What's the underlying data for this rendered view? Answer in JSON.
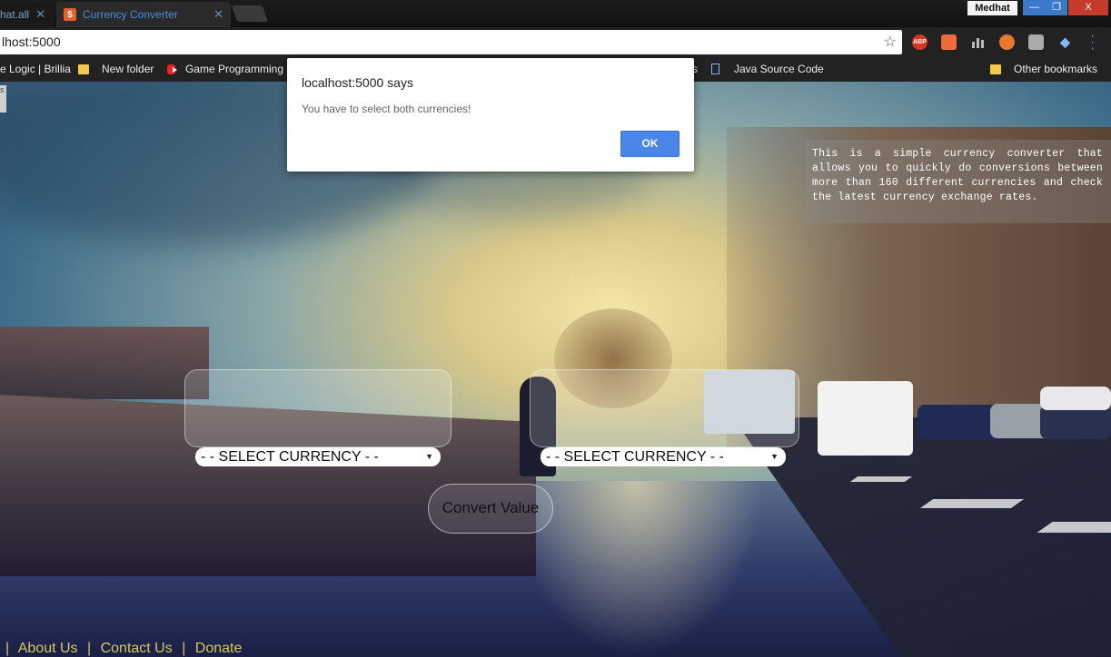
{
  "browser": {
    "tabs": [
      {
        "label": "hat.all",
        "active": false
      },
      {
        "label": "Currency Converter",
        "active": true,
        "favicon": "$"
      }
    ],
    "user_name": "Medhat",
    "window_controls": {
      "minimize": "—",
      "maximize": "❐",
      "close": "X"
    },
    "address": "lhost:5000",
    "extensions": [
      "ABP"
    ],
    "bookmarks": [
      {
        "label": "e Logic | Brillia",
        "icon": "page-icon"
      },
      {
        "label": "New folder",
        "icon": "folder-icon"
      },
      {
        "label": "Game Programming",
        "icon": "youtube-icon"
      },
      {
        "label": "s",
        "icon": "page-icon"
      },
      {
        "label": "Java Source Code",
        "icon": "document-icon"
      },
      {
        "label": "Other bookmarks",
        "icon": "folder-icon"
      }
    ]
  },
  "page": {
    "info_text": "This is a simple currency converter that allows you to quickly do conversions between more than 160 different currencies and check the latest currency exchange rates.",
    "from_currency": "- - SELECT CURRENCY - -",
    "to_currency": "- - SELECT CURRENCY - -",
    "convert_label": "Convert Value",
    "footer": {
      "about": "About Us",
      "contact": "Contact Us",
      "donate": "Donate",
      "separator": "|"
    },
    "side_tab": "s"
  },
  "dialog": {
    "title": "localhost:5000 says",
    "message": "You have to select both currencies!",
    "ok_label": "OK"
  },
  "colors": {
    "footer_link": "#d6c85a",
    "ok_button": "#4a86e8",
    "tab_accent": "#4a8fe0"
  }
}
